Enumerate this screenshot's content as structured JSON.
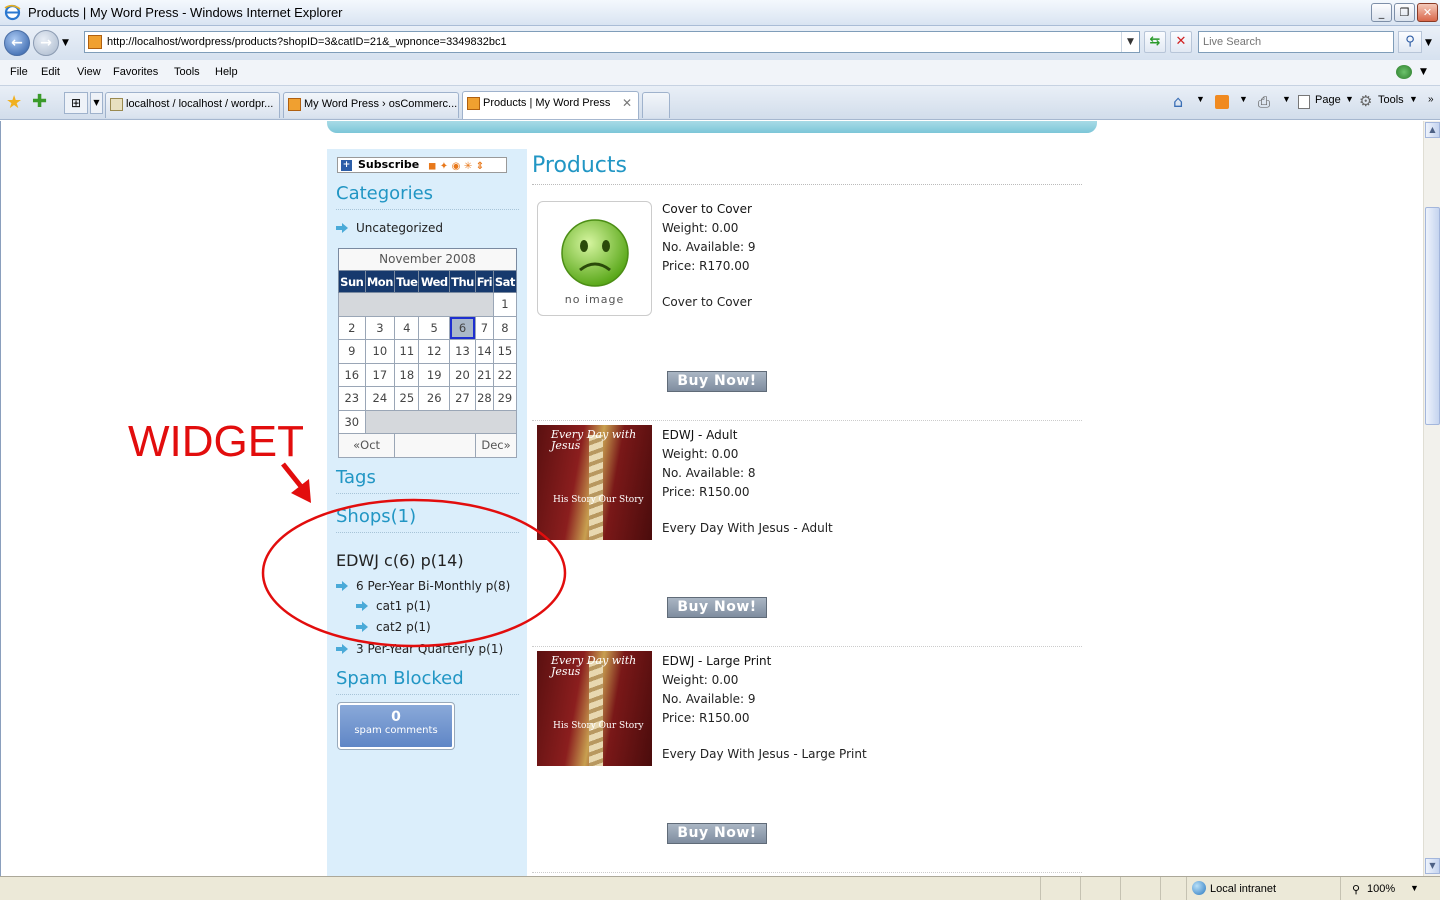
{
  "window": {
    "title": "Products | My Word Press - Windows Internet Explorer",
    "minimize": "_",
    "maximize": "❐",
    "close": "✕"
  },
  "address": {
    "url": "http://localhost/wordpress/products?shopID=3&catID=21&_wpnonce=3349832bc1",
    "search_placeholder": "Live Search"
  },
  "menu": [
    "File",
    "Edit",
    "View",
    "Favorites",
    "Tools",
    "Help"
  ],
  "tabs": [
    {
      "label": "localhost / localhost / wordpr..."
    },
    {
      "label": "My Word Press › osCommerc..."
    },
    {
      "label": "Products | My Word Press"
    }
  ],
  "commands": {
    "page": "Page",
    "tools": "Tools"
  },
  "status": {
    "zone": "Local intranet",
    "zoom": "100%"
  },
  "sidebar": {
    "subscribe": "Subscribe",
    "categories_title": "Categories",
    "categories": [
      "Uncategorized"
    ],
    "calendar": {
      "caption": "November 2008",
      "days": [
        "Sun",
        "Mon",
        "Tue",
        "Wed",
        "Thu",
        "Fri",
        "Sat"
      ],
      "weeks": [
        [
          "",
          "",
          "",
          "",
          "",
          "",
          "1"
        ],
        [
          "2",
          "3",
          "4",
          "5",
          "6",
          "7",
          "8"
        ],
        [
          "9",
          "10",
          "11",
          "12",
          "13",
          "14",
          "15"
        ],
        [
          "16",
          "17",
          "18",
          "19",
          "20",
          "21",
          "22"
        ],
        [
          "23",
          "24",
          "25",
          "26",
          "27",
          "28",
          "29"
        ],
        [
          "30",
          "",
          "",
          "",
          "",
          "",
          ""
        ]
      ],
      "today": "6",
      "prev": "«Oct",
      "next": "Dec»"
    },
    "tags_title": "Tags",
    "shops_title": "Shops(1)",
    "shop_name": "EDWJ c(6) p(14)",
    "shop_items": [
      {
        "label": "6 Per-Year Bi-Monthly p(8)"
      },
      {
        "label": "cat1 p(1)"
      },
      {
        "label": "cat2 p(1)"
      },
      {
        "label": "3 Per-Year Quarterly p(1)"
      }
    ],
    "spam_title": "Spam Blocked",
    "spam_count": "0",
    "spam_label": "spam comments"
  },
  "content": {
    "title": "Products",
    "products": [
      {
        "name": "Cover to Cover",
        "weight": "Weight: 0.00",
        "available": "No. Available: 9",
        "price": "Price: R170.00",
        "description": "Cover to Cover",
        "buy": "Buy Now!",
        "image_text": "no image"
      },
      {
        "name": "EDWJ - Adult",
        "weight": "Weight: 0.00",
        "available": "No. Available: 8",
        "price": "Price: R150.00",
        "description": "Every Day With Jesus - Adult",
        "buy": "Buy Now!",
        "cover_title": "Every Day with Jesus",
        "cover_sub": "His Story Our Story"
      },
      {
        "name": "EDWJ - Large Print",
        "weight": "Weight: 0.00",
        "available": "No. Available: 9",
        "price": "Price: R150.00",
        "description": "Every Day With Jesus - Large Print",
        "buy": "Buy Now!",
        "cover_title": "Every Day with Jesus",
        "cover_sub": "His Story Our Story"
      }
    ]
  },
  "annotation": {
    "label": "WIDGET",
    "color": "#e20d0d"
  }
}
